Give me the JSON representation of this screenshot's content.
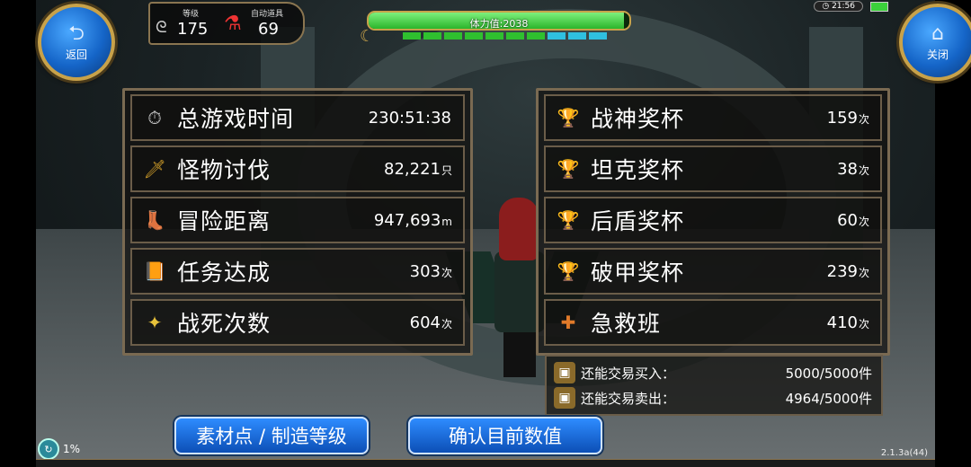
{
  "buttons": {
    "back": {
      "label": "返回",
      "icon": "back-arrow-icon"
    },
    "close": {
      "label": "关闭",
      "icon": "home-icon"
    }
  },
  "player": {
    "level_label": "等级",
    "level": "175",
    "potion_label": "自动道具",
    "potion_count": "69"
  },
  "stamina": {
    "label": "体力值:2038",
    "fill_fraction": 0.98
  },
  "status": {
    "time": "21:56"
  },
  "left_stats": [
    {
      "label": "总游戏时间",
      "value": "230:51:38",
      "unit": "",
      "icon": "stopwatch-icon"
    },
    {
      "label": "怪物讨伐",
      "value": "82,221",
      "unit": "只",
      "icon": "sword-icon"
    },
    {
      "label": "冒险距离",
      "value": "947,693",
      "unit": "m",
      "icon": "boot-icon"
    },
    {
      "label": "任务达成",
      "value": "303",
      "unit": "次",
      "icon": "book-icon"
    },
    {
      "label": "战死次数",
      "value": "604",
      "unit": "次",
      "icon": "star-swirl-icon"
    }
  ],
  "right_stats": [
    {
      "label": "战神奖杯",
      "value": "159",
      "unit": "次",
      "icon": "trophy-icon"
    },
    {
      "label": "坦克奖杯",
      "value": "38",
      "unit": "次",
      "icon": "trophy-icon"
    },
    {
      "label": "后盾奖杯",
      "value": "60",
      "unit": "次",
      "icon": "trophy-icon"
    },
    {
      "label": "破甲奖杯",
      "value": "239",
      "unit": "次",
      "icon": "trophy-icon"
    },
    {
      "label": "急救班",
      "value": "410",
      "unit": "次",
      "icon": "medic-icon"
    }
  ],
  "trade": [
    {
      "label": "还能交易买入：",
      "value": "5000/5000件",
      "icon": "chest-icon"
    },
    {
      "label": "还能交易卖出：",
      "value": "4964/5000件",
      "icon": "chest-icon"
    }
  ],
  "actions": {
    "materials": "素材点 / 制造等级",
    "confirm": "确认目前数值"
  },
  "progress": {
    "label": "1%"
  },
  "version": "2.1.3a(44)",
  "colors": {
    "accent_gold": "#c8a24a",
    "button_blue": "#1565c8",
    "stamina_green": "#2bb52b"
  }
}
